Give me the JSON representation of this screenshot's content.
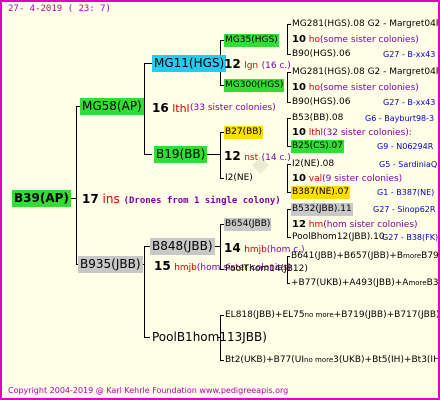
{
  "header": {
    "date": "27-  4-2019 (  23:  7)"
  },
  "footer": {
    "copyright": "Copyright 2004-2019 @ Karl Kehrle Foundation   www.pedigreeapis.org"
  },
  "colors": {
    "frame": "#e000c0",
    "green": "#33dd33",
    "cyan": "#22ccee",
    "yellow": "#ffdd00",
    "grey": "#c8c8c8"
  },
  "root": {
    "label": "B39(AP)",
    "gen_num": "17",
    "abbr": "ins",
    "note": "(Drones from 1 single colony)"
  },
  "mg58": {
    "label": "MG58(AP)",
    "gen_num": "16",
    "abbr": "lthl",
    "note": "(33 sister colonies)"
  },
  "mg11": {
    "label": "MG11(HGS)",
    "gen_num": "12",
    "abbr": "lgn",
    "note": "(16 c.)"
  },
  "mg35": {
    "label": "MG35(HGS)",
    "gen_num": "10",
    "abbr": "ho",
    "note": "(some sister colonies)"
  },
  "mg281a": "MG281(HGS).08 G2 - Margret04R",
  "b90a": "B90(HGS).06",
  "b90a_right": "G27 - B-xx43",
  "mg300": {
    "label": "MG300(HGS)",
    "gen_num": "10",
    "abbr": "ho",
    "note": "(some sister colonies)"
  },
  "mg281b": "MG281(HGS).08 G2 - Margret04R",
  "b90b": "B90(HGS).06",
  "b90b_right": "G27 - B-xx43",
  "b19": {
    "label": "B19(BB)",
    "gen_num": "12",
    "abbr": "nst",
    "note": "(14 c.)"
  },
  "b27": {
    "label": "B27(BB)",
    "gen_num": "10",
    "abbr": "lthl",
    "note": "(32 sister colonies):"
  },
  "b53": "B53(BB).08",
  "b53_right": "G6 - Bayburt98-3",
  "b25": "B25(CS).07",
  "b25_right": "G9 - N06294R",
  "i2": {
    "label": "I2(NE)",
    "gen_num": "10",
    "abbr": "val",
    "note": "(9 sister colonies)"
  },
  "i2_08": "I2(NE).08",
  "i2_08_right": "G5 - SardiniaQ",
  "b387": "B387(NE).07",
  "b387_right": "G1 - B387(NE)",
  "b935": {
    "label": "B935(JBB)",
    "gen_num": "15",
    "abbr": "hmjb",
    "note": "(hom sister colonies)"
  },
  "b848": {
    "label": "B848(JBB)",
    "gen_num": "14",
    "abbr": "hmjb",
    "note": "(hom c.)"
  },
  "b654": {
    "label": "B654(JBB)",
    "gen_num": "12",
    "abbr": "hm",
    "note": "(hom sister colonies)"
  },
  "b532": "B532(JBB).11",
  "b532_right": "G27 - Sinop62R",
  "poolb": "PoolBhom12(JBB).10",
  "poolb_right": "G27 - B38(FK)+3",
  "poolthom": "PoolThom14(JB12)",
  "b641": "B641(JBB)+B657(JBB)+B",
  "b641_mid": "more",
  "b641_right": "B79(JBB)",
  "b77": "+B77(UKB)+A493(JBB)+A",
  "b77_mid": "more",
  "b77_right": "B36(JBB)",
  "poolb1": "PoolB1hom113JBB)",
  "el818": "EL818(JBB)+EL75",
  "el818_mid": "no more",
  "el818_right": "+B719(JBB)+B717(JBB)",
  "bt2": "Bt2(UKB)+B77(UI",
  "bt2_mid": "no more",
  "bt2_right": "3(UKB)+Bt5(IH)+Bt3(IH)"
}
